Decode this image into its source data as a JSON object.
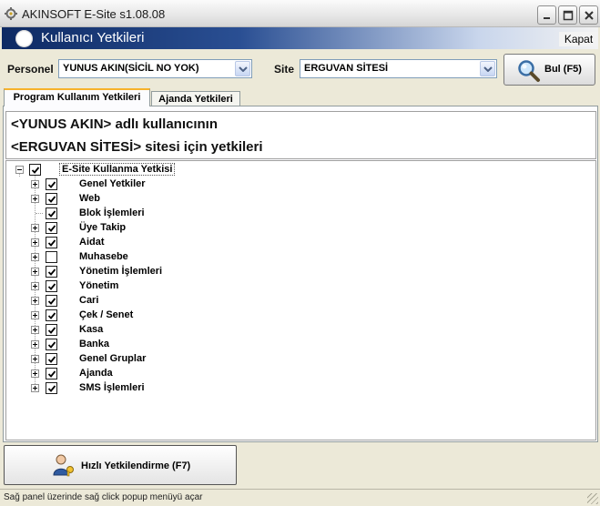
{
  "window": {
    "title": "AKINSOFT E-Site s1.08.08"
  },
  "header": {
    "title": "Kullanıcı Yetkileri",
    "close_label": "Kapat"
  },
  "filters": {
    "personnel_label": "Personel",
    "personnel_value": "YUNUS AKIN(SİCİL NO YOK)",
    "site_label": "Site",
    "site_value": "ERGUVAN  SİTESİ",
    "find_button": "Bul (F5)"
  },
  "tabs": [
    {
      "label": "Program Kullanım Yetkileri",
      "active": true
    },
    {
      "label": "Ajanda Yetkileri",
      "active": false
    }
  ],
  "info": {
    "line1": "<YUNUS AKIN> adlı kullanıcının",
    "line2": "<ERGUVAN  SİTESİ> sitesi için yetkileri"
  },
  "tree": {
    "root": {
      "label": "E-Site Kullanma Yetkisi",
      "checked": true,
      "expanded": true
    },
    "items": [
      {
        "label": "Genel Yetkiler",
        "checked": true,
        "expandable": true
      },
      {
        "label": "Web",
        "checked": true,
        "expandable": true
      },
      {
        "label": "Blok İşlemleri",
        "checked": true,
        "expandable": false
      },
      {
        "label": "Üye Takip",
        "checked": true,
        "expandable": true
      },
      {
        "label": "Aidat",
        "checked": true,
        "expandable": true
      },
      {
        "label": "Muhasebe",
        "checked": false,
        "expandable": true
      },
      {
        "label": "Yönetim İşlemleri",
        "checked": true,
        "expandable": true
      },
      {
        "label": "Yönetim",
        "checked": true,
        "expandable": true
      },
      {
        "label": "Cari",
        "checked": true,
        "expandable": true
      },
      {
        "label": "Çek / Senet",
        "checked": true,
        "expandable": true
      },
      {
        "label": "Kasa",
        "checked": true,
        "expandable": true
      },
      {
        "label": "Banka",
        "checked": true,
        "expandable": true
      },
      {
        "label": "Genel Gruplar",
        "checked": true,
        "expandable": true
      },
      {
        "label": "Ajanda",
        "checked": true,
        "expandable": true
      },
      {
        "label": "SMS İşlemleri",
        "checked": true,
        "expandable": true
      }
    ]
  },
  "bottom": {
    "quick_button": "Hızlı Yetkilendirme (F7)"
  },
  "status": {
    "text": "Sağ panel üzerinde sağ click popup menüyü açar"
  },
  "icons": {
    "app": "cog-app-icon",
    "find": "magnifier-icon",
    "quick": "user-key-icon",
    "checkbox_mark": "check-icon"
  },
  "colors": {
    "header_dark": "#0e2a63",
    "tab_active_accent": "#f7b22b",
    "combo_border": "#7f9db9"
  }
}
